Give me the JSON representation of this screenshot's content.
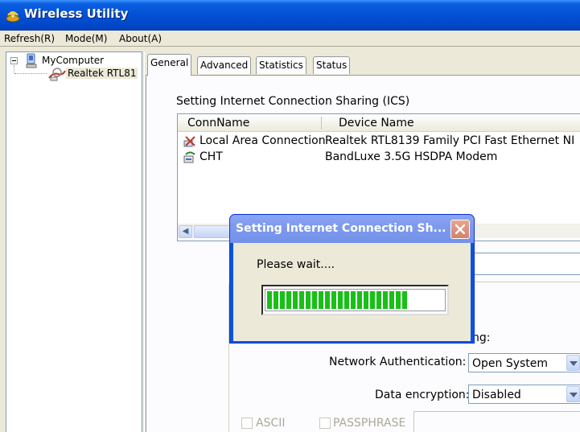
{
  "window": {
    "title": "Wireless Utility",
    "icon": "wireless-utility-app-icon"
  },
  "menubar": {
    "items": [
      "Refresh(R)",
      "Mode(M)",
      "About(A)"
    ]
  },
  "tree": {
    "root_label": "MyComputer",
    "root_icon": "computer-icon",
    "child_label": "Realtek RTL81",
    "child_icon": "network-adapter-icon"
  },
  "tabs": [
    "General",
    "Advanced",
    "Statistics",
    "Status"
  ],
  "active_tab": "General",
  "ics": {
    "title": "Setting Internet Connection Sharing (ICS)",
    "columns": [
      "ConnName",
      "Device Name"
    ],
    "rows": [
      {
        "name": "Local Area Connection",
        "device": "Realtek RTL8139 Family PCI Fast Ethernet NI",
        "icon": "lan-connection-icon"
      },
      {
        "name": "CHT",
        "device": "BandLuxe 3.5G HSDPA Modem",
        "icon": "dialup-connection-icon"
      }
    ]
  },
  "security": {
    "partial_label": "ng:",
    "network_auth_label": "Network Authentication:",
    "network_auth_value": "Open System",
    "data_encryption_label": "Data encryption:",
    "data_encryption_value": "Disabled",
    "ascii_label": "ASCII",
    "passphrase_label": "PASSPHRASE"
  },
  "dialog": {
    "title": "Setting Internet Connection Sh...",
    "message": "Please wait....",
    "progress_fraction": 0.78,
    "progress_color": "#18c018"
  },
  "colors": {
    "titlebar": "#0451d3",
    "dialog_titlebar": "#7d9aee",
    "window_bg": "#ece9d8",
    "close_button": "#d4816a"
  }
}
